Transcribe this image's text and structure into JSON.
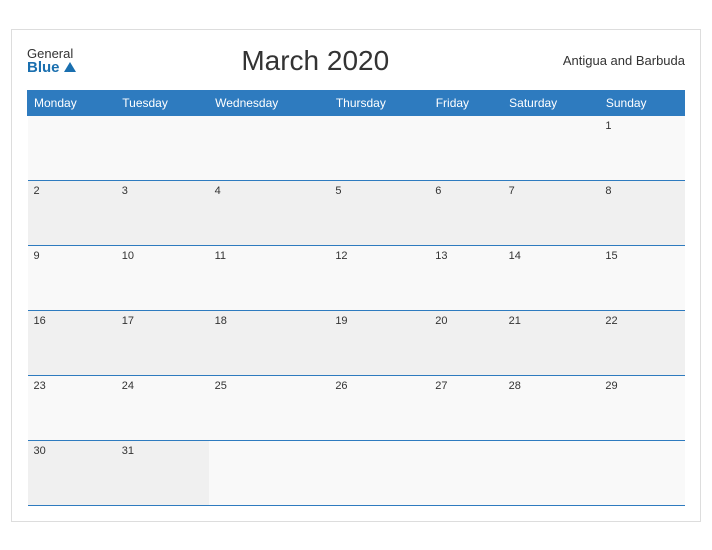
{
  "header": {
    "logo_general": "General",
    "logo_blue": "Blue",
    "title": "March 2020",
    "country": "Antigua and Barbuda"
  },
  "weekdays": [
    "Monday",
    "Tuesday",
    "Wednesday",
    "Thursday",
    "Friday",
    "Saturday",
    "Sunday"
  ],
  "weeks": [
    [
      null,
      null,
      null,
      null,
      null,
      null,
      1
    ],
    [
      2,
      3,
      4,
      5,
      6,
      7,
      8
    ],
    [
      9,
      10,
      11,
      12,
      13,
      14,
      15
    ],
    [
      16,
      17,
      18,
      19,
      20,
      21,
      22
    ],
    [
      23,
      24,
      25,
      26,
      27,
      28,
      29
    ],
    [
      30,
      31,
      null,
      null,
      null,
      null,
      null
    ]
  ]
}
